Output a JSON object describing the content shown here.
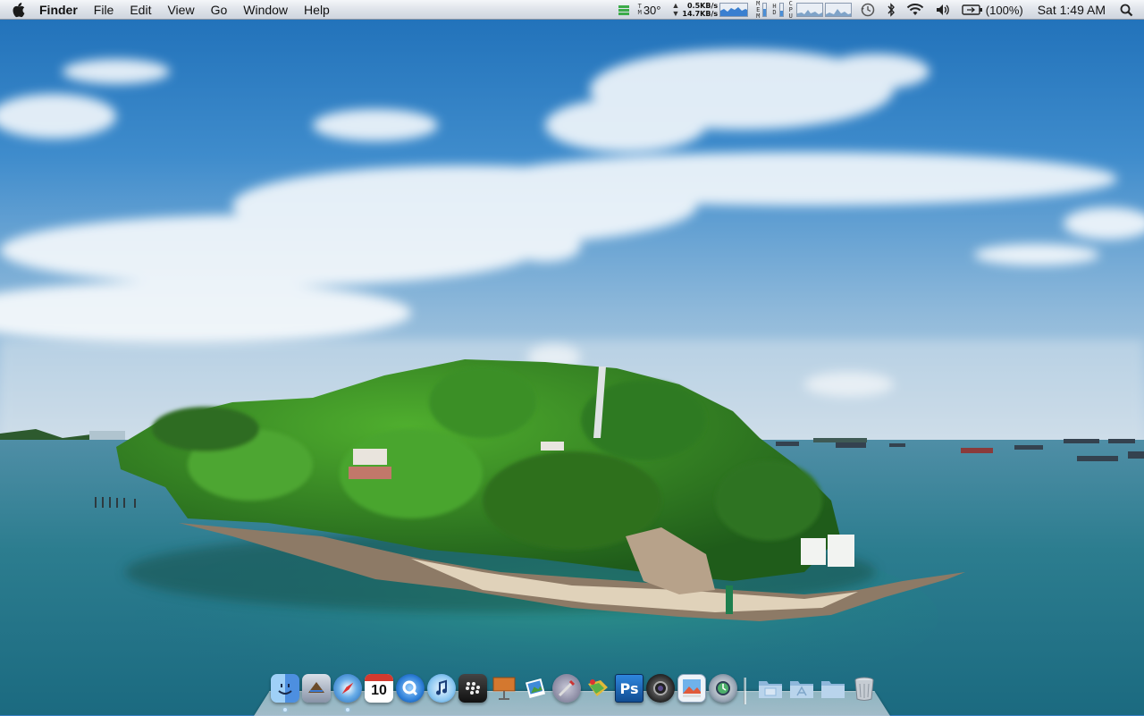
{
  "menubar": {
    "app_name": "Finder",
    "menus": [
      "File",
      "Edit",
      "View",
      "Go",
      "Window",
      "Help"
    ],
    "extras": {
      "temperature_label": "TMP",
      "temperature": "30°",
      "net_up": "0.5KB/s",
      "net_down": "14.7KB/s",
      "mem_label": "MEM",
      "hdd_label": "HDD",
      "cpu_label": "CPU",
      "battery": "(100%)",
      "clock": "Sat 1:49 AM"
    },
    "icons": [
      "apple-icon",
      "istat-activity-icon",
      "temperature-icon",
      "network-icon",
      "memory-icon",
      "disk-icon",
      "cpu-icon",
      "time-machine-icon",
      "bluetooth-icon",
      "wifi-icon",
      "volume-icon",
      "battery-icon",
      "spotlight-icon"
    ]
  },
  "dock": {
    "apps": [
      {
        "name": "finder-icon",
        "label": "Finder",
        "color": "#5aa2e8",
        "running": true
      },
      {
        "name": "mail-icon",
        "label": "Mail",
        "color": "#7d8fb3",
        "running": false
      },
      {
        "name": "safari-icon",
        "label": "Safari",
        "color": "#2f82d6",
        "running": true
      },
      {
        "name": "ical-icon",
        "label": "iCal",
        "date": "10",
        "color": "#ffffff",
        "running": false
      },
      {
        "name": "quicktime-icon",
        "label": "QuickTime",
        "color": "#1f6fd0",
        "running": false
      },
      {
        "name": "itunes-icon",
        "label": "iTunes",
        "color": "#4fa3e3",
        "running": false
      },
      {
        "name": "blackberry-icon",
        "label": "BlackBerry",
        "color": "#222222",
        "running": false
      },
      {
        "name": "keynote-icon",
        "label": "Keynote",
        "color": "#c46a2c",
        "running": false
      },
      {
        "name": "iphoto-icon",
        "label": "iPhoto",
        "color": "#d9e6f2",
        "running": false
      },
      {
        "name": "script-editor-icon",
        "label": "Script Editor",
        "color": "#6b6b88",
        "running": false
      },
      {
        "name": "transmit-icon",
        "label": "Transmit",
        "color": "#59b04a",
        "running": false
      },
      {
        "name": "photoshop-icon",
        "label": "Ps",
        "color": "#1e6fbf",
        "running": false
      },
      {
        "name": "photo-booth-icon",
        "label": "Photo Booth",
        "color": "#3a3a3a",
        "running": false
      },
      {
        "name": "preview-icon",
        "label": "Preview",
        "color": "#c9dcef",
        "running": false
      },
      {
        "name": "time-machine-app-icon",
        "label": "Time Machine",
        "color": "#3c4e63",
        "running": false
      }
    ],
    "folders": [
      {
        "name": "documents-folder-icon",
        "label": "Documents"
      },
      {
        "name": "applications-folder-icon",
        "label": "Applications"
      },
      {
        "name": "downloads-folder-icon",
        "label": "Downloads"
      }
    ],
    "trash": {
      "name": "trash-icon",
      "label": "Trash"
    }
  }
}
